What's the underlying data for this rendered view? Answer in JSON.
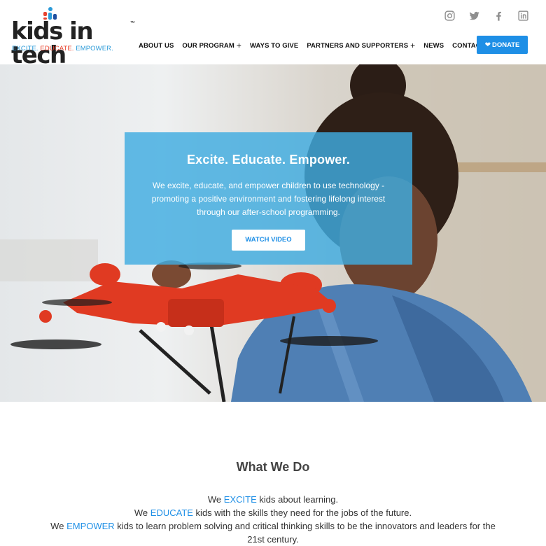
{
  "brand": {
    "name": "kids in tech",
    "trademark": "™",
    "tagline_1": "EXCITE.",
    "tagline_2": "EDUCATE.",
    "tagline_3": "EMPOWER.",
    "dot_colors": [
      "#e8432e",
      "#2a9ad8",
      "#1f4fa0"
    ]
  },
  "social": [
    "instagram-icon",
    "twitter-icon",
    "facebook-icon",
    "linkedin-icon"
  ],
  "nav": {
    "items": [
      {
        "label": "ABOUT US",
        "has_submenu": false
      },
      {
        "label": "OUR PROGRAM",
        "has_submenu": true
      },
      {
        "label": "WAYS TO GIVE",
        "has_submenu": false
      },
      {
        "label": "PARTNERS AND SUPPORTERS",
        "has_submenu": true
      },
      {
        "label": "NEWS",
        "has_submenu": false
      },
      {
        "label": "CONTACT US",
        "has_submenu": false
      }
    ],
    "submenu_glyph": "+",
    "donate_label": "DONATE"
  },
  "hero": {
    "title": "Excite. Educate. Empower.",
    "text": "We excite, educate, and empower children to use technology - promoting a positive environment and fostering lifelong interest through our after-school programming.",
    "button_label": "WATCH VIDEO"
  },
  "what_we_do": {
    "title": "What We Do",
    "line1": {
      "pre": "We ",
      "hl": "EXCITE",
      "post": " kids about learning."
    },
    "line2": {
      "pre": "We ",
      "hl": "EDUCATE",
      "post": " kids with the skills they need for the jobs of the future."
    },
    "line3": {
      "pre": "We ",
      "hl": "EMPOWER",
      "post": " kids to learn problem solving and critical thinking skills to be the innovators and leaders for the 21st century."
    }
  },
  "colors": {
    "accent": "#1e8fe6",
    "hero_overlay": "#40ace0",
    "drone": "#e03a22"
  }
}
